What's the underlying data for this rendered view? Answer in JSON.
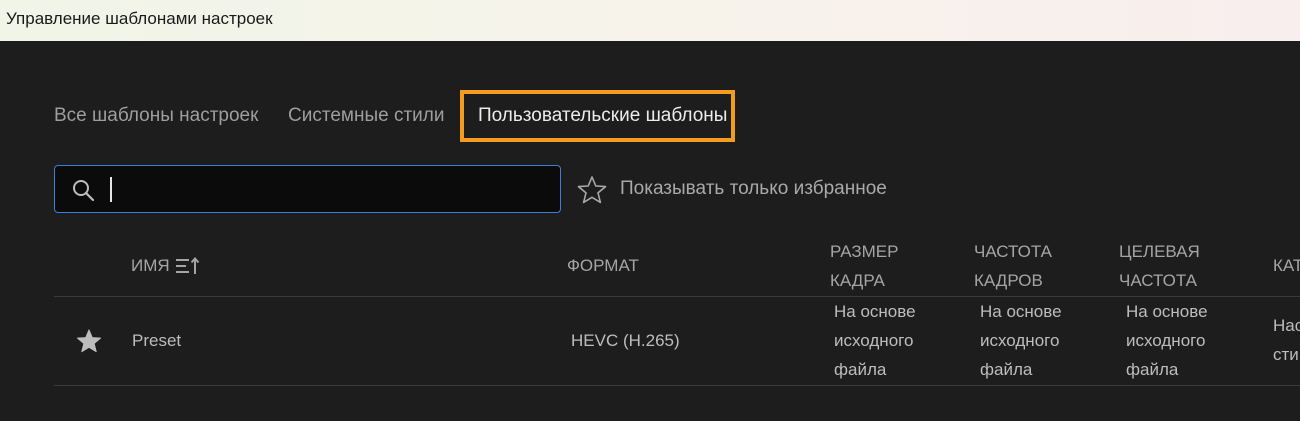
{
  "window": {
    "title": "Управление шаблонами настроек"
  },
  "tabs": [
    {
      "label": "Все шаблоны настроек",
      "selected": false
    },
    {
      "label": "Системные стили",
      "selected": false
    },
    {
      "label": "Пользовательские шаблоны",
      "selected": true
    }
  ],
  "colors": {
    "highlight": "#f39c1f",
    "focus": "#3d7fd8",
    "background": "#1d1d1d"
  },
  "search": {
    "value": "",
    "placeholder": ""
  },
  "favorites_filter": {
    "label": "Показывать только избранное",
    "checked": false
  },
  "table": {
    "columns": {
      "name": "ИМЯ",
      "format": "ФОРМАТ",
      "size_l1": "РАЗМЕР",
      "size_l2": "КАДРА",
      "rate_l1": "ЧАСТОТА",
      "rate_l2": "КАДРОВ",
      "target_l1": "ЦЕЛЕВАЯ",
      "target_l2": "ЧАСТОТА",
      "category": "КАТ"
    },
    "rows": [
      {
        "favorite": true,
        "name": "Preset",
        "format": "HEVC (H.265)",
        "size": [
          "На основе",
          "исходного",
          "файла"
        ],
        "rate": [
          "На основе",
          "исходного",
          "файла"
        ],
        "target": [
          "На основе",
          "исходного",
          "файла"
        ],
        "category": [
          "Нас",
          "сти"
        ]
      }
    ]
  }
}
